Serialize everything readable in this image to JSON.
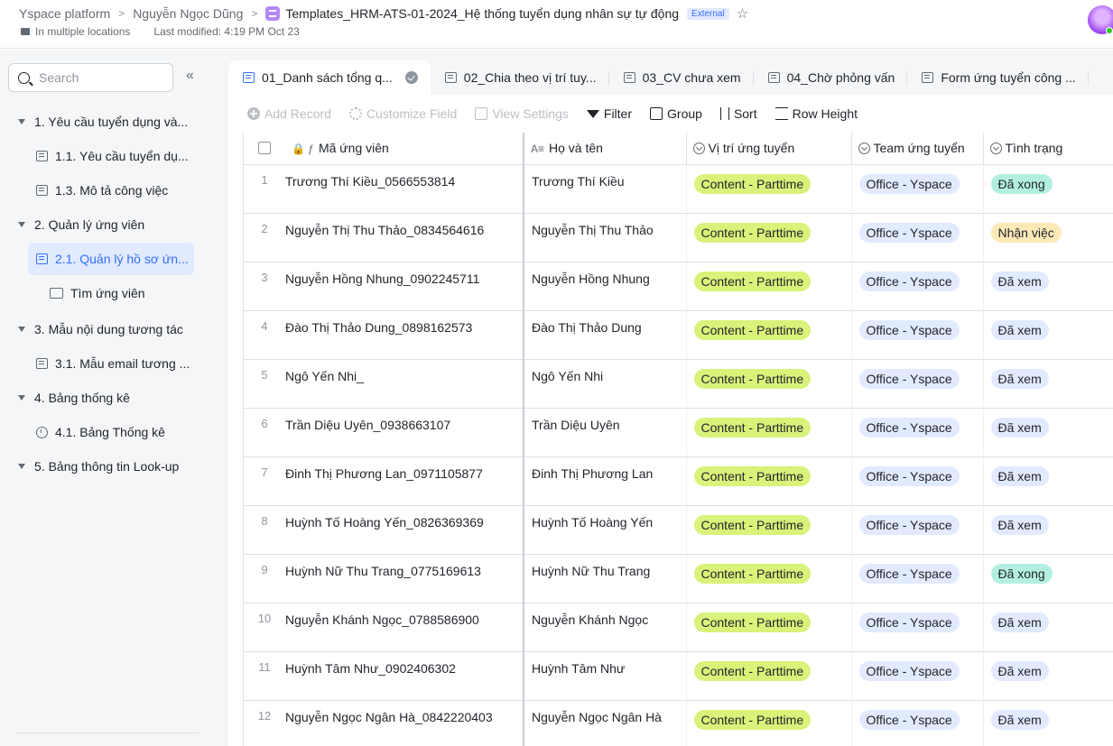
{
  "header": {
    "crumbs": [
      "Yspace platform",
      "Nguyễn Ngọc Dũng"
    ],
    "doc_title": "Templates_HRM-ATS-01-2024_Hệ thống tuyển dụng nhân sự tự động",
    "badge": "External",
    "location": "In multiple locations",
    "modified": "Last modified: 4:19 PM Oct 23"
  },
  "sidebar": {
    "search_placeholder": "Search",
    "items": [
      {
        "label": "1. Yêu cầu tuyển dụng và..."
      },
      {
        "label": "1.1. Yêu cầu tuyển dụ..."
      },
      {
        "label": "1.3. Mô tả công việc"
      },
      {
        "label": "2. Quản lý ứng viên"
      },
      {
        "label": "2.1. Quản lý hồ sơ ứn..."
      },
      {
        "label": "Tìm ứng viên"
      },
      {
        "label": "3. Mẫu nội dung tương tác"
      },
      {
        "label": "3.1. Mẫu email tương ..."
      },
      {
        "label": "4. Bảng thống kê"
      },
      {
        "label": "4.1. Bảng Thống kê"
      },
      {
        "label": "5. Bảng thông tin Look-up"
      }
    ]
  },
  "tabs": [
    {
      "label": "01_Danh sách tổng q..."
    },
    {
      "label": "02_Chia theo vị trí tuy..."
    },
    {
      "label": "03_CV chưa xem"
    },
    {
      "label": "04_Chờ phỏng vấn"
    },
    {
      "label": "Form ứng tuyển công ..."
    }
  ],
  "toolbar": {
    "add_record": "Add Record",
    "customize_field": "Customize Field",
    "view_settings": "View Settings",
    "filter": "Filter",
    "group": "Group",
    "sort": "Sort",
    "row_height": "Row Height"
  },
  "columns": {
    "id": "Mã ứng viên",
    "name": "Họ và tên",
    "position": "Vị trí ứng tuyển",
    "team": "Team ứng tuyển",
    "status": "Tình trạng"
  },
  "rows": [
    {
      "num": "1",
      "id": "Trương Thí Kiều_0566553814",
      "name": "Trương Thí Kiều",
      "position": "Content  - Parttime",
      "team": "Office - Yspace",
      "status": "Đã xong",
      "status_color": "green"
    },
    {
      "num": "2",
      "id": "Nguyễn Thị Thu Thảo_0834564616",
      "name": "Nguyễn Thị Thu Thảo",
      "position": "Content  - Parttime",
      "team": "Office - Yspace",
      "status": "Nhận việc",
      "status_color": "yellow"
    },
    {
      "num": "3",
      "id": "Nguyễn Hồng Nhung_0902245711",
      "name": "Nguyễn Hồng Nhung",
      "position": "Content  - Parttime",
      "team": "Office - Yspace",
      "status": "Đã xem",
      "status_color": "gray"
    },
    {
      "num": "4",
      "id": "Đào Thị Thảo Dung_0898162573",
      "name": "Đào Thị Thảo Dung",
      "position": "Content  - Parttime",
      "team": "Office - Yspace",
      "status": "Đã xem",
      "status_color": "gray"
    },
    {
      "num": "5",
      "id": "Ngô Yến Nhi_",
      "name": "Ngô Yến Nhi",
      "position": "Content  - Parttime",
      "team": "Office - Yspace",
      "status": "Đã xem",
      "status_color": "gray"
    },
    {
      "num": "6",
      "id": "Trần Diệu Uyên_0938663107",
      "name": "Trần Diệu Uyên",
      "position": "Content  - Parttime",
      "team": "Office - Yspace",
      "status": "Đã xem",
      "status_color": "gray"
    },
    {
      "num": "7",
      "id": "Đinh Thị Phương Lan_0971105877",
      "name": "Đinh Thị Phương Lan",
      "position": "Content  - Parttime",
      "team": "Office - Yspace",
      "status": "Đã xem",
      "status_color": "gray"
    },
    {
      "num": "8",
      "id": "Huỳnh Tố Hoàng Yến_0826369369",
      "name": "Huỳnh Tố Hoàng Yến",
      "position": "Content  - Parttime",
      "team": "Office - Yspace",
      "status": "Đã xem",
      "status_color": "gray"
    },
    {
      "num": "9",
      "id": "Huỳnh Nữ Thu Trang_0775169613",
      "name": "Huỳnh Nữ Thu Trang",
      "position": "Content  - Parttime",
      "team": "Office - Yspace",
      "status": "Đã xong",
      "status_color": "green"
    },
    {
      "num": "10",
      "id": "Nguyễn Khánh Ngọc_0788586900",
      "name": "Nguyễn Khánh Ngọc",
      "position": "Content  - Parttime",
      "team": "Office - Yspace",
      "status": "Đã xem",
      "status_color": "gray"
    },
    {
      "num": "11",
      "id": "Huỳnh Tâm Như_0902406302",
      "name": "Huỳnh Tâm Như",
      "position": "Content  - Parttime",
      "team": "Office - Yspace",
      "status": "Đã xem",
      "status_color": "gray"
    },
    {
      "num": "12",
      "id": "Nguyễn Ngọc Ngân Hà_0842220403",
      "name": "Nguyễn Ngọc Ngân Hà",
      "position": "Content  - Parttime",
      "team": "Office - Yspace",
      "status": "Đã xem",
      "status_color": "gray"
    }
  ],
  "colors": {
    "accent": "#3370ff",
    "position_tag": "#d9f27a",
    "team_tag": "#e1eaff",
    "done": "#b3efe0",
    "accepted": "#fde8b8"
  }
}
